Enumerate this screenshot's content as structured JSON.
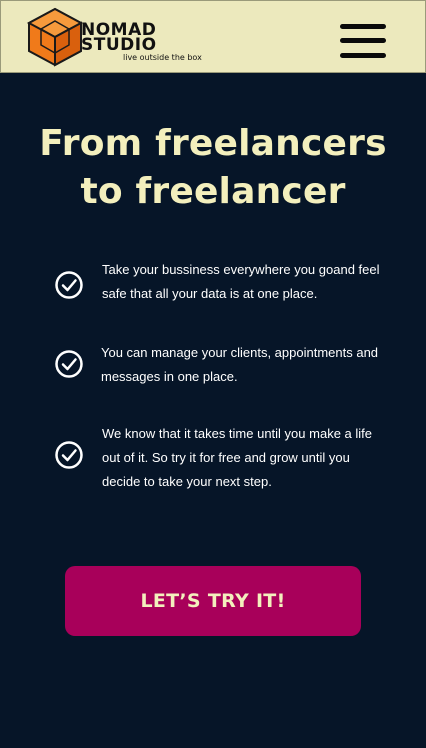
{
  "header": {
    "brand_line1": "NOMAD",
    "brand_line2": "STUDIO",
    "tagline": "live outside the box",
    "logo_icon": "cube-logo-icon",
    "menu_icon": "hamburger-menu-icon"
  },
  "hero": {
    "title_line1": "From freelancers",
    "title_line2": "to freelancer"
  },
  "features": [
    {
      "icon": "check-circle-icon",
      "text": "Take your bussiness everywhere you goand feel safe that all your data is at one place."
    },
    {
      "icon": "check-circle-icon",
      "text": "You can manage your clients, appointments and messages in one place."
    },
    {
      "icon": "check-circle-icon",
      "text": "We know that it takes time until you make a life out of it. So try it for free and grow until you decide to take your next step."
    }
  ],
  "cta": {
    "label": "LET’S TRY IT!"
  },
  "colors": {
    "background": "#061528",
    "header_background": "#ece9bd",
    "title": "#f3efbd",
    "cta_background": "#a8005a",
    "logo_orange": "#f07a1a"
  }
}
